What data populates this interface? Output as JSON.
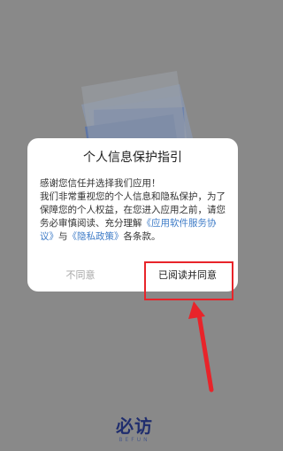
{
  "dialog": {
    "title": "个人信息保护指引",
    "line1": "感谢您信任并选择我们应用！",
    "line2_a": "我们非常重视您的个人信息和隐私保护，为了保障您的个人权益，在您进入应用之前，请您务必审慎阅读、充分理解",
    "link_service": "《应用软件服务协议》",
    "line2_and": "与",
    "link_privacy": "《隐私政策》",
    "line2_end": "各条款。",
    "disagree_label": "不同意",
    "agree_label": "已阅读并同意"
  },
  "logo": {
    "text": "必访",
    "subtext": "BEFUN"
  },
  "colors": {
    "overlay": "#898989",
    "link": "#3f7cc7",
    "highlight": "#e8242a",
    "logo": "#1f2d6e"
  }
}
